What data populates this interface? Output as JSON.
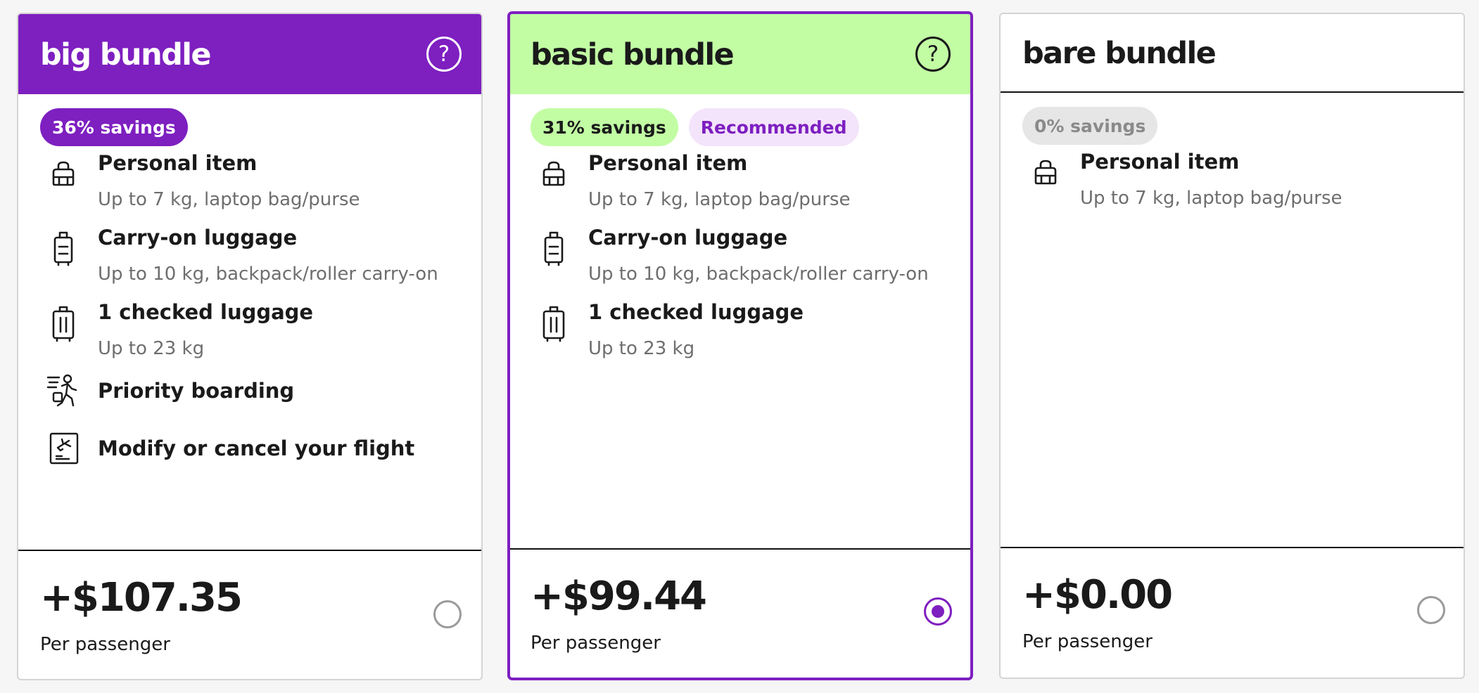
{
  "colors": {
    "purple": "#7e1fc0",
    "lime": "#c2fda4",
    "lavender": "#f3e4fb",
    "grey_badge": "#e6e6e6"
  },
  "bundles": [
    {
      "name": "big bundle",
      "help_symbol": "?",
      "savings": "36% savings",
      "features": [
        {
          "icon": "personal-item-bag-icon",
          "title": "Personal item",
          "desc": "Up to 7 kg, laptop bag/purse"
        },
        {
          "icon": "carry-on-suitcase-icon",
          "title": "Carry-on luggage",
          "desc": "Up to 10 kg, backpack/roller carry-on"
        },
        {
          "icon": "checked-luggage-icon",
          "title": "1 checked luggage",
          "desc": "Up to 23 kg"
        },
        {
          "icon": "priority-boarding-icon",
          "title": "Priority boarding"
        },
        {
          "icon": "modify-ticket-icon",
          "title": "Modify or cancel your flight"
        }
      ],
      "price": "+$107.35",
      "per": "Per passenger",
      "selected": false
    },
    {
      "name": "basic bundle",
      "help_symbol": "?",
      "savings": "31% savings",
      "recommended": "Recommended",
      "features": [
        {
          "icon": "personal-item-bag-icon",
          "title": "Personal item",
          "desc": "Up to 7 kg, laptop bag/purse"
        },
        {
          "icon": "carry-on-suitcase-icon",
          "title": "Carry-on luggage",
          "desc": "Up to 10 kg, backpack/roller carry-on"
        },
        {
          "icon": "checked-luggage-icon",
          "title": "1 checked luggage",
          "desc": "Up to 23 kg"
        }
      ],
      "price": "+$99.44",
      "per": "Per passenger",
      "selected": true
    },
    {
      "name": "bare bundle",
      "savings": "0% savings",
      "features": [
        {
          "icon": "personal-item-bag-icon",
          "title": "Personal item",
          "desc": "Up to 7 kg, laptop bag/purse"
        }
      ],
      "price": "+$0.00",
      "per": "Per passenger",
      "selected": false
    }
  ]
}
